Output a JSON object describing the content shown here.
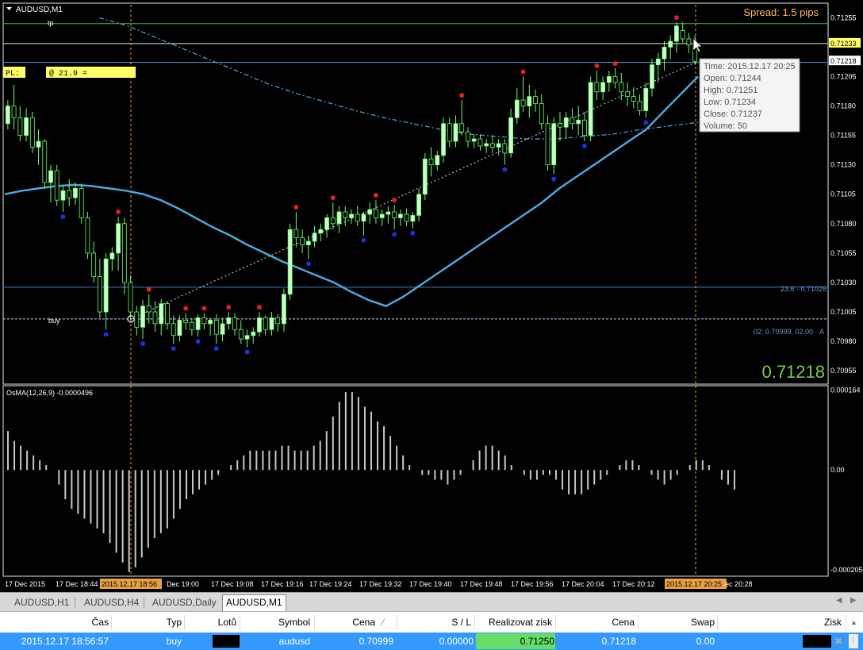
{
  "symbol_title": "AUDUSD,M1",
  "spread_text": "Spread: 1.5 pips",
  "tp_label": "tp",
  "pl_label": "PL:",
  "pl_value": "@ 21.9 =",
  "buy_label": "buy",
  "fib_label": "23.6 - 0.71026",
  "order_label": "02: 0.70999, 02.00",
  "order_suffix": "A",
  "big_price": "0.71218",
  "indicator_label": "OsMA(12,26,9) -0.0000496",
  "price_axis": [
    "0.71255",
    "0.71233",
    "0.71218",
    "0.71205",
    "0.71180",
    "0.71155",
    "0.71130",
    "0.71105",
    "0.71080",
    "0.71055",
    "0.71030",
    "0.71005",
    "0.70980",
    "0.70955"
  ],
  "osma_axis": [
    "0.000164",
    "0.00",
    "-0.000205"
  ],
  "time_axis": [
    "17 Dec 2015",
    "17 Dec 18:44",
    "2015.12.17 18:56",
    "Dec 19:00",
    "17 Dec 19:08",
    "17 Dec 19:16",
    "17 Dec 19:24",
    "17 Dec 19:32",
    "17 Dec 19:40",
    "17 Dec 19:48",
    "17 Dec 19:56",
    "17 Dec 20:04",
    "17 Dec 20:12",
    "2015.12.17 20:25",
    "ec 20:28"
  ],
  "tooltip": {
    "time": "Time: 2015.12.17 20:25",
    "open": "Open: 0.71244",
    "high": "High: 0.71251",
    "low": "Low:  0.71234",
    "close": "Close: 0.71237",
    "volume": "Volume: 50"
  },
  "tabs": [
    "AUDUSD,H1",
    "AUDUSD,H4",
    "AUDUSD,Daily",
    "AUDUSD,M1"
  ],
  "columns": [
    "Čas",
    "Typ",
    "Lotů",
    "Symbol",
    "Cena",
    "S / L",
    "Realizovat zisk",
    "Cena",
    "Swap",
    "Zisk"
  ],
  "row": {
    "time": "2015.12.17 18:56:57",
    "type": "buy",
    "symbol": "audusd",
    "price": "0.70999",
    "sl": "0.00000",
    "tp": "0.71250",
    "current": "0.71218",
    "swap": "0.00"
  },
  "colors": {
    "bull": "#ccffcc",
    "bear": "#000000",
    "wick": "#66ff66",
    "ma": "#4aa8e0",
    "hist": "#c8c8c8",
    "fractal_up": "#dd2222",
    "fractal_down": "#1a2fdd",
    "selection": "#3399ff"
  },
  "chart_data": {
    "type": "candlestick",
    "symbol": "AUDUSD",
    "timeframe": "M1",
    "candles": [
      [
        0.71165,
        0.71185,
        0.7116,
        0.7118
      ],
      [
        0.7118,
        0.71198,
        0.7116,
        0.7117
      ],
      [
        0.7117,
        0.7118,
        0.7115,
        0.71155
      ],
      [
        0.71155,
        0.71178,
        0.7115,
        0.7117
      ],
      [
        0.7117,
        0.71175,
        0.7114,
        0.71145
      ],
      [
        0.71145,
        0.7116,
        0.7113,
        0.7115
      ],
      [
        0.7115,
        0.71152,
        0.7111,
        0.71115
      ],
      [
        0.71115,
        0.7113,
        0.71098,
        0.71125
      ],
      [
        0.71125,
        0.7113,
        0.71095,
        0.711
      ],
      [
        0.711,
        0.71112,
        0.7109,
        0.71108
      ],
      [
        0.71108,
        0.71118,
        0.71095,
        0.71102
      ],
      [
        0.71102,
        0.71115,
        0.71096,
        0.7111
      ],
      [
        0.7111,
        0.71114,
        0.7108,
        0.71085
      ],
      [
        0.71085,
        0.7109,
        0.7105,
        0.71055
      ],
      [
        0.71055,
        0.71065,
        0.7103,
        0.71035
      ],
      [
        0.71035,
        0.7105,
        0.71,
        0.71005
      ],
      [
        0.71005,
        0.71055,
        0.7099,
        0.7105
      ],
      [
        0.7105,
        0.7106,
        0.7104,
        0.71055
      ],
      [
        0.71055,
        0.71086,
        0.7104,
        0.7108
      ],
      [
        0.7108,
        0.71085,
        0.7102,
        0.7103
      ],
      [
        0.7103,
        0.71036,
        0.70998,
        0.71005
      ],
      [
        0.71005,
        0.7101,
        0.70985,
        0.70992
      ],
      [
        0.70992,
        0.71015,
        0.70982,
        0.7101
      ],
      [
        0.7101,
        0.7102,
        0.70995,
        0.71005
      ],
      [
        0.71005,
        0.71014,
        0.70988,
        0.70995
      ],
      [
        0.70995,
        0.71016,
        0.70985,
        0.71012
      ],
      [
        0.71012,
        0.71014,
        0.7099,
        0.70995
      ],
      [
        0.70995,
        0.71002,
        0.70978,
        0.70985
      ],
      [
        0.70985,
        0.71002,
        0.7098,
        0.70998
      ],
      [
        0.70998,
        0.71004,
        0.7099,
        0.70996
      ],
      [
        0.70996,
        0.71,
        0.70985,
        0.7099
      ],
      [
        0.7099,
        0.71003,
        0.70984,
        0.71
      ],
      [
        0.71,
        0.71004,
        0.7099,
        0.70995
      ],
      [
        0.70995,
        0.71,
        0.70985,
        0.70998
      ],
      [
        0.70998,
        0.71003,
        0.70978,
        0.70986
      ],
      [
        0.70986,
        0.71,
        0.7098,
        0.70995
      ],
      [
        0.70995,
        0.71005,
        0.7099,
        0.71
      ],
      [
        0.71,
        0.71004,
        0.70985,
        0.7099
      ],
      [
        0.7099,
        0.70998,
        0.70978,
        0.70982
      ],
      [
        0.70982,
        0.7099,
        0.70975,
        0.70985
      ],
      [
        0.70985,
        0.70992,
        0.70978,
        0.70988
      ],
      [
        0.70988,
        0.71005,
        0.70984,
        0.71
      ],
      [
        0.71,
        0.71002,
        0.70985,
        0.7099
      ],
      [
        0.7099,
        0.71005,
        0.70985,
        0.71
      ],
      [
        0.71,
        0.71003,
        0.70988,
        0.70995
      ],
      [
        0.70995,
        0.71025,
        0.70988,
        0.7102
      ],
      [
        0.7102,
        0.7108,
        0.71015,
        0.71075
      ],
      [
        0.71075,
        0.7109,
        0.7106,
        0.71068
      ],
      [
        0.71068,
        0.71075,
        0.71055,
        0.71062
      ],
      [
        0.71062,
        0.7107,
        0.7105,
        0.71065
      ],
      [
        0.71065,
        0.71078,
        0.7106,
        0.71072
      ],
      [
        0.71072,
        0.7108,
        0.71065,
        0.71075
      ],
      [
        0.71075,
        0.71088,
        0.71068,
        0.71085
      ],
      [
        0.71085,
        0.71098,
        0.71075,
        0.7108
      ],
      [
        0.7108,
        0.71095,
        0.71072,
        0.7109
      ],
      [
        0.7109,
        0.71095,
        0.71078,
        0.71085
      ],
      [
        0.71085,
        0.71092,
        0.7108,
        0.71088
      ],
      [
        0.71088,
        0.71095,
        0.71078,
        0.71082
      ],
      [
        0.71082,
        0.7109,
        0.7107,
        0.71088
      ],
      [
        0.71088,
        0.71098,
        0.7108,
        0.71092
      ],
      [
        0.71092,
        0.711,
        0.7108,
        0.71085
      ],
      [
        0.71085,
        0.71092,
        0.71078,
        0.71088
      ],
      [
        0.71088,
        0.71095,
        0.7108,
        0.7109
      ],
      [
        0.7109,
        0.71096,
        0.71075,
        0.71085
      ],
      [
        0.71085,
        0.71092,
        0.71078,
        0.71088
      ],
      [
        0.71088,
        0.71093,
        0.71078,
        0.71082
      ],
      [
        0.71082,
        0.7109,
        0.71076,
        0.71087
      ],
      [
        0.71087,
        0.7111,
        0.71082,
        0.71105
      ],
      [
        0.71105,
        0.7114,
        0.711,
        0.71135
      ],
      [
        0.71135,
        0.71145,
        0.7112,
        0.7113
      ],
      [
        0.7113,
        0.71142,
        0.71125,
        0.71138
      ],
      [
        0.71138,
        0.7117,
        0.71132,
        0.71165
      ],
      [
        0.71165,
        0.7117,
        0.71145,
        0.7115
      ],
      [
        0.7115,
        0.71172,
        0.71145,
        0.71165
      ],
      [
        0.71165,
        0.71185,
        0.71155,
        0.71158
      ],
      [
        0.71158,
        0.71162,
        0.71145,
        0.7115
      ],
      [
        0.7115,
        0.71156,
        0.71144,
        0.71152
      ],
      [
        0.71152,
        0.71156,
        0.71142,
        0.71146
      ],
      [
        0.71146,
        0.71152,
        0.7114,
        0.71148
      ],
      [
        0.71148,
        0.71155,
        0.7114,
        0.71145
      ],
      [
        0.71145,
        0.71152,
        0.71138,
        0.71148
      ],
      [
        0.71148,
        0.71152,
        0.7113,
        0.7114
      ],
      [
        0.7114,
        0.71178,
        0.71136,
        0.7117
      ],
      [
        0.7117,
        0.71195,
        0.71165,
        0.71185
      ],
      [
        0.71185,
        0.71205,
        0.71175,
        0.7118
      ],
      [
        0.7118,
        0.71198,
        0.7117,
        0.71188
      ],
      [
        0.71188,
        0.71194,
        0.71175,
        0.71182
      ],
      [
        0.71182,
        0.7119,
        0.7116,
        0.71165
      ],
      [
        0.71165,
        0.71172,
        0.71125,
        0.7113
      ],
      [
        0.7113,
        0.7117,
        0.71122,
        0.71165
      ],
      [
        0.71165,
        0.71175,
        0.7115,
        0.71162
      ],
      [
        0.71162,
        0.71175,
        0.71152,
        0.7117
      ],
      [
        0.7117,
        0.71178,
        0.7116,
        0.71165
      ],
      [
        0.71165,
        0.7118,
        0.71155,
        0.71168
      ],
      [
        0.71168,
        0.71175,
        0.7115,
        0.71155
      ],
      [
        0.71155,
        0.71205,
        0.7115,
        0.712
      ],
      [
        0.712,
        0.7121,
        0.71185,
        0.71192
      ],
      [
        0.71192,
        0.71205,
        0.71185,
        0.712
      ],
      [
        0.712,
        0.7121,
        0.71192,
        0.71205
      ],
      [
        0.71205,
        0.71212,
        0.71195,
        0.712
      ],
      [
        0.712,
        0.71208,
        0.71185,
        0.71192
      ],
      [
        0.71192,
        0.712,
        0.7118,
        0.71188
      ],
      [
        0.71188,
        0.71196,
        0.71178,
        0.71184
      ],
      [
        0.71184,
        0.7119,
        0.71172,
        0.71176
      ],
      [
        0.71176,
        0.712,
        0.7117,
        0.71195
      ],
      [
        0.71195,
        0.7122,
        0.71188,
        0.71215
      ],
      [
        0.71215,
        0.71225,
        0.712,
        0.7122
      ],
      [
        0.7122,
        0.71235,
        0.7121,
        0.7123
      ],
      [
        0.7123,
        0.7124,
        0.7122,
        0.71235
      ],
      [
        0.71235,
        0.71251,
        0.71225,
        0.71248
      ],
      [
        0.71244,
        0.71251,
        0.71234,
        0.71237
      ],
      [
        0.71237,
        0.71242,
        0.71225,
        0.71232
      ],
      [
        0.71232,
        0.7124,
        0.71215,
        0.71218
      ]
    ],
    "ma_fast": [
      0.71105,
      0.71108,
      0.7111,
      0.71112,
      0.71113,
      0.71112,
      0.7111,
      0.71108,
      0.71105,
      0.711,
      0.71093,
      0.71085,
      0.71077,
      0.7107,
      0.71062,
      0.71055,
      0.71048,
      0.71042,
      0.71036,
      0.7103,
      0.71022,
      0.71015,
      0.7101,
      0.71018,
      0.71028,
      0.71038,
      0.71048,
      0.71058,
      0.71068,
      0.71078,
      0.71088,
      0.71098,
      0.7111,
      0.7112,
      0.7113,
      0.7114,
      0.7115,
      0.7116,
      0.71175,
      0.7119,
      0.71205
    ],
    "ma_slow": [
      0.71255,
      0.71248,
      0.71238,
      0.71228,
      0.71218,
      0.71208,
      0.71198,
      0.7119,
      0.71183,
      0.71176,
      0.7117,
      0.71165,
      0.7116,
      0.71156,
      0.71154,
      0.71152,
      0.71152,
      0.71154,
      0.71156,
      0.7116,
      0.71163,
      0.71166
    ],
    "osma": [
      8e-05,
      6e-05,
      5e-05,
      4e-05,
      3e-05,
      2e-05,
      1e-05,
      -0.0,
      -3e-05,
      -6e-05,
      -8e-05,
      -9e-05,
      -0.0001,
      -0.00011,
      -0.00012,
      -0.00013,
      -0.00015,
      -0.00017,
      -0.00019,
      -0.00021,
      -0.0002,
      -0.00018,
      -0.00016,
      -0.00014,
      -0.00013,
      -0.00012,
      -0.0001,
      -8e-05,
      -6e-05,
      -5e-05,
      -4e-05,
      -3e-05,
      -2e-05,
      -1e-05,
      0.0,
      1e-05,
      2e-05,
      3e-05,
      4e-05,
      4e-05,
      4e-05,
      4e-05,
      4e-05,
      5e-05,
      5e-05,
      4e-05,
      4e-05,
      4e-05,
      5e-05,
      6e-05,
      8e-05,
      0.00011,
      0.00014,
      0.00016,
      0.00016,
      0.00015,
      0.00013,
      0.00012,
      0.0001,
      9e-05,
      7e-05,
      5e-05,
      3e-05,
      1e-05,
      0.0,
      -1e-05,
      -1e-05,
      -2e-05,
      -2e-05,
      -3e-05,
      -2e-05,
      -1e-05,
      0.0,
      2e-05,
      4e-05,
      5e-05,
      5e-05,
      4e-05,
      3e-05,
      1e-05,
      0.0,
      -1e-05,
      -2e-05,
      -2e-05,
      -1e-05,
      -1e-05,
      -2e-05,
      -4e-05,
      -5e-05,
      -5e-05,
      -5e-05,
      -4e-05,
      -3e-05,
      -2e-05,
      -1e-05,
      0.0,
      1e-05,
      2e-05,
      2e-05,
      1e-05,
      0.0,
      -1e-05,
      -2e-05,
      -3e-05,
      -2e-05,
      -1e-05,
      0.0,
      1e-05,
      2e-05,
      2e-05,
      1e-05,
      0.0,
      -2e-05,
      -3e-05,
      -4e-05
    ],
    "levels": {
      "tp": 0.7125,
      "current": 0.71233,
      "bid": 0.71218,
      "pl_line": 0.71217,
      "fib_23_6": 0.71026,
      "buy_entry": 0.70999
    },
    "y_range": [
      0.70945,
      0.71266
    ],
    "osma_range": [
      -0.000215,
      0.00017
    ]
  }
}
